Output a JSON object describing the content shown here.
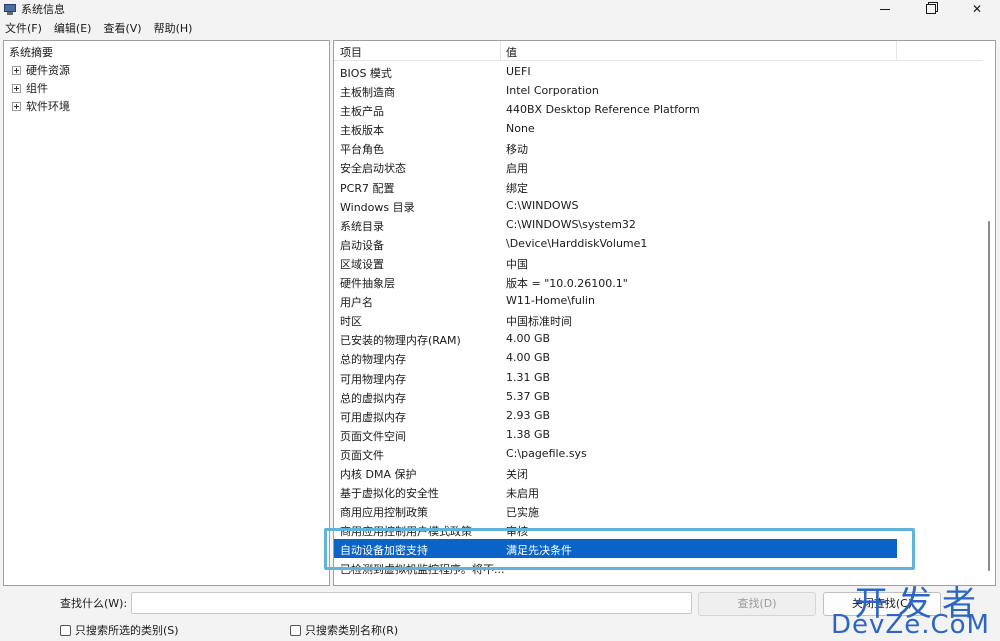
{
  "window": {
    "title": "系统信息",
    "controls": {
      "close": "✕"
    }
  },
  "menu": [
    "文件(F)",
    "编辑(E)",
    "查看(V)",
    "帮助(H)"
  ],
  "tree": {
    "root": "系统摘要",
    "nodes": [
      "硬件资源",
      "组件",
      "软件环境"
    ]
  },
  "list": {
    "columns": [
      "项目",
      "值"
    ],
    "rows": [
      {
        "item": "BIOS 模式",
        "value": "UEFI"
      },
      {
        "item": "主板制造商",
        "value": "Intel Corporation"
      },
      {
        "item": "主板产品",
        "value": "440BX Desktop Reference Platform"
      },
      {
        "item": "主板版本",
        "value": "None"
      },
      {
        "item": "平台角色",
        "value": "移动"
      },
      {
        "item": "安全启动状态",
        "value": "启用"
      },
      {
        "item": "PCR7 配置",
        "value": "绑定"
      },
      {
        "item": "Windows 目录",
        "value": "C:\\WINDOWS"
      },
      {
        "item": "系统目录",
        "value": "C:\\WINDOWS\\system32"
      },
      {
        "item": "启动设备",
        "value": "\\Device\\HarddiskVolume1"
      },
      {
        "item": "区域设置",
        "value": "中国"
      },
      {
        "item": "硬件抽象层",
        "value": "版本 = \"10.0.26100.1\""
      },
      {
        "item": "用户名",
        "value": "W11-Home\\fulin"
      },
      {
        "item": "时区",
        "value": "中国标准时间"
      },
      {
        "item": "已安装的物理内存(RAM)",
        "value": "4.00 GB"
      },
      {
        "item": "总的物理内存",
        "value": "4.00 GB"
      },
      {
        "item": "可用物理内存",
        "value": "1.31 GB"
      },
      {
        "item": "总的虚拟内存",
        "value": "5.37 GB"
      },
      {
        "item": "可用虚拟内存",
        "value": "2.93 GB"
      },
      {
        "item": "页面文件空间",
        "value": "1.38 GB"
      },
      {
        "item": "页面文件",
        "value": "C:\\pagefile.sys"
      },
      {
        "item": "内核 DMA 保护",
        "value": "关闭"
      },
      {
        "item": "基于虚拟化的安全性",
        "value": "未启用"
      },
      {
        "item": "商用应用控制政策",
        "value": "已实施"
      },
      {
        "item": "商用应用控制用户模式政策",
        "value": "审核"
      },
      {
        "item": "自动设备加密支持",
        "value": "满足先决条件"
      },
      {
        "item": "已检测到虚拟机监控程序。将不...",
        "value": ""
      }
    ],
    "selected_index": 25
  },
  "find": {
    "label": "查找什么(W):",
    "value": "",
    "find_button": "查找(D)",
    "close_button": "关闭查找(C)",
    "option_selected_category": "只搜索所选的类别(S)",
    "option_category_names": "只搜索类别名称(R)"
  },
  "watermark": {
    "cn": "开发者",
    "en": "DevZe.CoM"
  },
  "colors": {
    "selection": "#0a64c8",
    "highlight_box": "#5fb4d8",
    "watermark": "#2d66c2"
  }
}
